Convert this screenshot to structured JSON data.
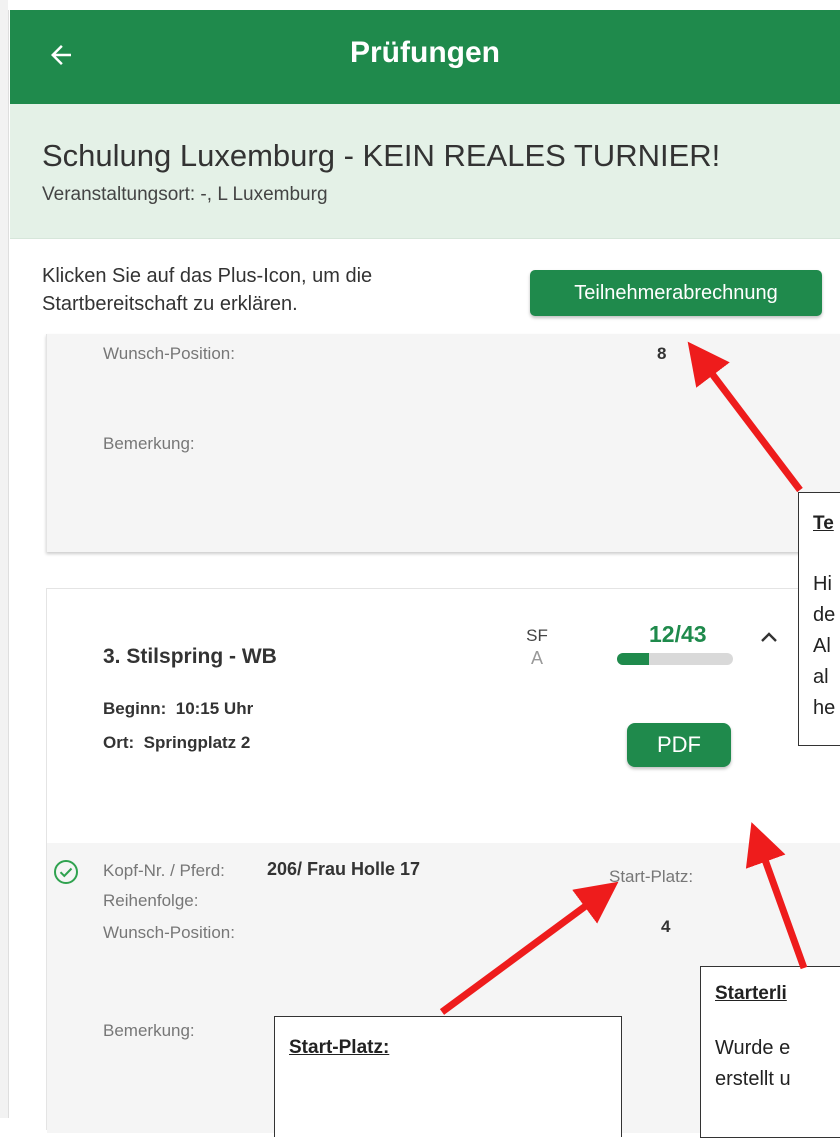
{
  "app": {
    "title": "Prüfungen"
  },
  "event": {
    "name": "Schulung Luxemburg - KEIN REALES TURNIER!",
    "location": "Veranstaltungsort: -, L Luxemburg"
  },
  "hint": "Klicken Sie auf das Plus-Icon, um die Startbereitschaft zu erklären.",
  "buttons": {
    "participant_billing": "Teilnehmerabrechnung",
    "pdf": "PDF"
  },
  "card_prev": {
    "wish_position_label": "Wunsch-Position:",
    "wish_position_value": "8",
    "remark_label": "Bemerkung:"
  },
  "competition": {
    "title": "3. Stilspring - WB",
    "sf": "SF",
    "sf_sub": "A",
    "count": "12/43",
    "progress": 0.28,
    "start_label": "Beginn:",
    "start_time": "10:15 Uhr",
    "place_label": "Ort:",
    "place": "Springplatz 2"
  },
  "entry": {
    "head_label": "Kopf-Nr. / Pferd:",
    "head_value": "206/ Frau Holle 17",
    "order_label": "Reihenfolge:",
    "wish_position_label": "Wunsch-Position:",
    "start_place_label": "Start-Platz:",
    "start_place_value": "4",
    "remark_label": "Bemerkung:"
  },
  "callouts": {
    "participant": {
      "head": "Te",
      "lines": [
        "Hi",
        "de",
        "Al",
        "al",
        "he"
      ]
    },
    "starterlist": {
      "head": "Starterli",
      "lines": [
        "Wurde e",
        "erstellt u"
      ]
    },
    "startplace": {
      "head": "Start-Platz:"
    }
  },
  "colors": {
    "primary": "#1f8a4c",
    "header_bg": "#e4f1e7",
    "arrow": "#ee1c1c"
  }
}
